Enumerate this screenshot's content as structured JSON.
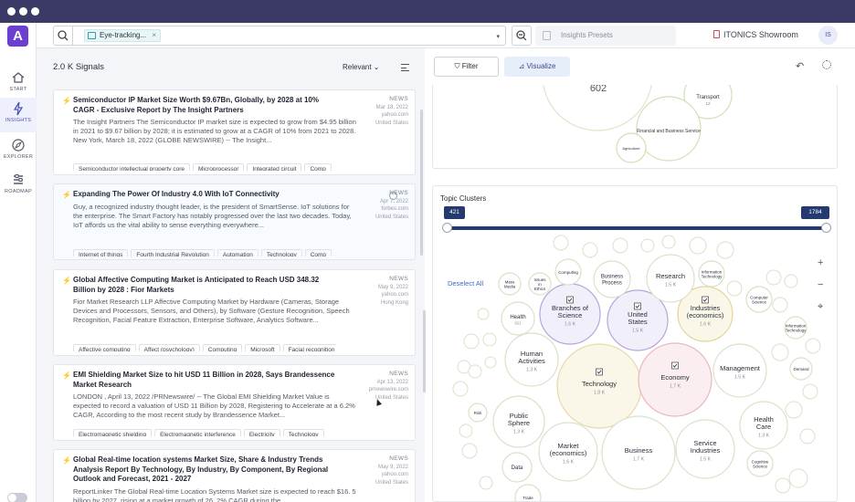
{
  "app": {
    "logo_letter": "A",
    "nav": [
      {
        "label": "START",
        "icon": "home-icon"
      },
      {
        "label": "INSIGHTS",
        "icon": "bolt-icon"
      },
      {
        "label": "EXPLORER",
        "icon": "compass-icon"
      },
      {
        "label": "ROADMAP",
        "icon": "roadmap-icon"
      }
    ],
    "active_nav": "INSIGHTS"
  },
  "topbar": {
    "search_chip": "Eye-tracking...",
    "chip_close": "×",
    "dropdown": "▾",
    "presets_placeholder": "Insights Presets",
    "workspace": "ITONICS Showroom",
    "avatar": "IS"
  },
  "list": {
    "count": "2.0 K Signals",
    "sort_label": "Relevant ⌄",
    "cards": [
      {
        "title": "Semiconductor IP Market Size Worth $9.67Bn, Globally, by 2028 at 10% CAGR - Exclusive Report by The Insight Partners",
        "body": "The Insight Partners The Semiconductor IP market size is expected to grow from $4.95 billion in 2021 to $9.67 billion by 2028; it is estimated to grow at a CAGR of 10% from 2021 to 2028. New York, March 18, 2022 (GLOBE NEWSWIRE) -- The Insight...",
        "type": "NEWS",
        "date": "Mar 18, 2022",
        "source": "yahoo.com",
        "location": "United States",
        "tags": [
          "Semiconductor intellectual property core",
          "Microprocessor",
          "Integrated circuit",
          "Comp"
        ]
      },
      {
        "title": "Expanding The Power Of Industry 4.0 With IoT Connectivity",
        "body": "Guy, a recognized industry thought leader, is the president of SmartSense. IoT solutions for the enterprise. The Smart Factory has notably progressed over the last two decades. Today, IoT affords us the vital ability to sense everything everywhere...",
        "type": "NEWS",
        "date": "Apr 7, 2022",
        "source": "forbes.com",
        "location": "United States",
        "tags": [
          "Internet of things",
          "Fourth Industrial Revolution",
          "Automation",
          "Technology",
          "Comp"
        ]
      },
      {
        "title": "Global Affective Computing Market is Anticipated to Reach USD 348.32 Billion by 2028 : Fior Markets",
        "body": "Fior Market Research LLP Affective Computing Market by Hardware (Cameras, Storage Devices and Processors, Sensors, and Others), by Software (Gesture Recognition, Speech Recognition, Facial Feature Extraction, Enterprise Software, Analytics Software...",
        "type": "NEWS",
        "date": "May 9, 2022",
        "source": "yahoo.com",
        "location": "Hong Kong",
        "tags": [
          "Affective computing",
          "Affect (psychology)",
          "Computing",
          "Microsoft",
          "Facial recognition"
        ]
      },
      {
        "title": "EMI Shielding Market Size to hit USD 11 Billion in 2028, Says Brandessence Market Research",
        "body": "LONDON , April 13, 2022 /PRNewswire/ -- The Global EMI Shielding Market Value is expected to record a valuation of USD 11 Billion by 2028, Registering to Accelerate at a 6.2% CAGR, According to the most recent study by Brandessence Market...",
        "type": "NEWS",
        "date": "Apr 13, 2022",
        "source": "prnewswire.com",
        "location": "United States",
        "tags": [
          "Electromagnetic shielding",
          "Electromagnetic interference",
          "Electricity",
          "Technology"
        ]
      },
      {
        "title": "Global Real-time location systems Market Size, Share & Industry Trends Analysis Report By Technology, By Industry, By Component, By Regional Outlook and Forecast, 2021 - 2027",
        "body": "ReportLinker The Global Real-time Location Systems Market size is expected to reach $16. 5 billion by 2027, rising at a market growth of 26. 2% CAGR during the...",
        "type": "NEWS",
        "date": "May 9, 2022",
        "source": "yahoo.com",
        "location": "United States",
        "tags": []
      }
    ]
  },
  "viz": {
    "filter_label": "Filter",
    "visualize_label": "Visualize",
    "top_bubbles": [
      {
        "label": "602",
        "sub": ""
      },
      {
        "label": "Transport",
        "sub": "12"
      },
      {
        "label": "Financial and Business Service",
        "sub": ""
      },
      {
        "label": "Agriculture",
        "sub": ""
      }
    ],
    "clusters_title": "Topic Clusters",
    "range_min": "421",
    "range_max": "1784",
    "deselect": "Deselect All",
    "zoom_in": "+",
    "zoom_out": "−",
    "locate": "⌖",
    "bubbles": [
      {
        "label": "Technology",
        "count": "1.8 K",
        "checked": true
      },
      {
        "label": "Economy",
        "count": "1.7 K",
        "checked": true
      },
      {
        "label": "Branches of Science",
        "count": "1.6 K",
        "checked": true
      },
      {
        "label": "United States",
        "count": "1.5 K",
        "checked": true
      },
      {
        "label": "Industries (economics)",
        "count": "1.6 K",
        "checked": true
      },
      {
        "label": "Business",
        "count": "1.7 K",
        "checked": false
      },
      {
        "label": "Market (economics)",
        "count": "1.6 K",
        "checked": false
      },
      {
        "label": "Service Industries",
        "count": "1.5 K",
        "checked": false
      },
      {
        "label": "Human Activities",
        "count": "1.3 K",
        "checked": false
      },
      {
        "label": "Public Sphere",
        "count": "1.3 K",
        "checked": false
      },
      {
        "label": "Management",
        "count": "1.5 K",
        "checked": false
      },
      {
        "label": "Health Care",
        "count": "1.3 K",
        "checked": false
      },
      {
        "label": "Research",
        "count": "1.5 K",
        "checked": false
      },
      {
        "label": "Business Process",
        "count": "",
        "checked": false
      },
      {
        "label": "Health",
        "count": "821",
        "checked": false
      },
      {
        "label": "Information Technology",
        "count": "",
        "checked": false
      },
      {
        "label": "Data",
        "count": "",
        "checked": false
      },
      {
        "label": "Trade",
        "count": "",
        "checked": false
      },
      {
        "label": "Risk",
        "count": "",
        "checked": false
      },
      {
        "label": "Mass Media",
        "count": "",
        "checked": false
      },
      {
        "label": "Issues in Ethics",
        "count": "",
        "checked": false
      },
      {
        "label": "Computing",
        "count": "",
        "checked": false
      },
      {
        "label": "Computer Science",
        "count": "",
        "checked": false
      },
      {
        "label": "Cognitive Science",
        "count": "",
        "checked": false
      },
      {
        "label": "Demand",
        "count": "",
        "checked": false
      },
      {
        "label": "Information Technology",
        "count": "",
        "checked": false
      }
    ]
  }
}
